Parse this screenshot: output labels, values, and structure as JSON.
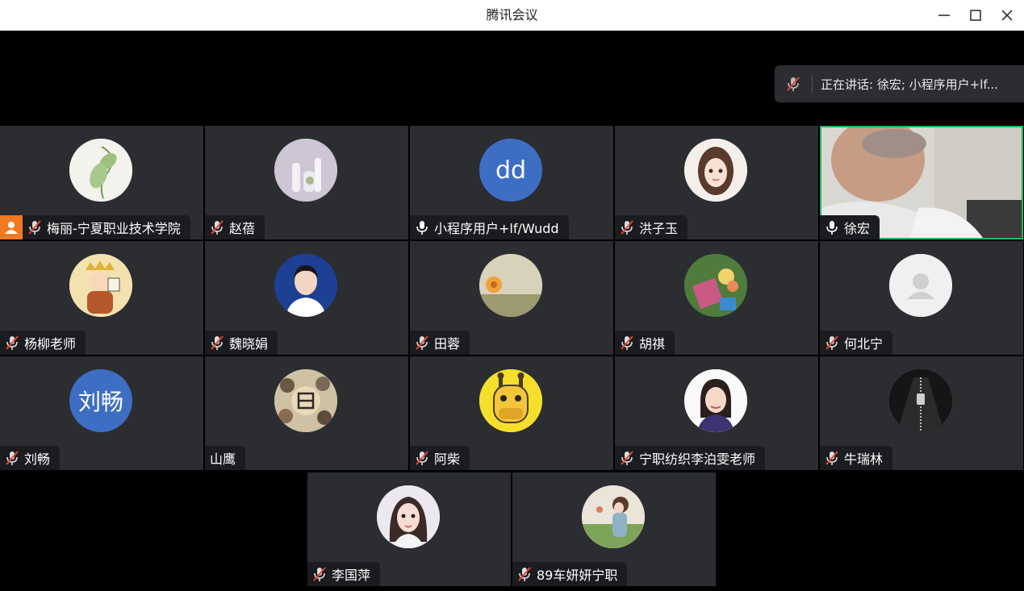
{
  "window": {
    "title": "腾讯会议"
  },
  "speaking": {
    "text": "正在讲话:  徐宏; 小程序用户+lf..."
  },
  "participants": [
    {
      "name": "梅丽-宁夏职业技术学院",
      "muted": true,
      "host": true,
      "avatar": "leaf-plant"
    },
    {
      "name": "赵蓓",
      "muted": true,
      "avatar": "white-vase"
    },
    {
      "name": "小程序用户+lf/Wudd",
      "muted": false,
      "avatar_text": "dd"
    },
    {
      "name": "洪子玉",
      "muted": true,
      "avatar": "cartoon-girl"
    },
    {
      "name": "徐宏",
      "muted": false,
      "video": true
    },
    {
      "name": "杨柳老师",
      "muted": true,
      "avatar": "cartoon-liberty"
    },
    {
      "name": "魏晓娟",
      "muted": true,
      "avatar": "woman-portrait"
    },
    {
      "name": "田蓉",
      "muted": true,
      "avatar": "orange-flower"
    },
    {
      "name": "胡祺",
      "muted": true,
      "avatar": "flowers-outdoor"
    },
    {
      "name": "何北宁",
      "muted": true,
      "avatar": "default-person"
    },
    {
      "name": "刘畅",
      "muted": true,
      "avatar_text": "刘畅"
    },
    {
      "name": "山鹰",
      "muted": false,
      "avatar": "photo-collage"
    },
    {
      "name": "阿柴",
      "muted": true,
      "avatar": "giraffe-cartoon"
    },
    {
      "name": "宁职纺织李泊雯老师",
      "muted": true,
      "avatar": "woman-smile"
    },
    {
      "name": "牛瑞林",
      "muted": true,
      "avatar": "leather-jacket"
    },
    {
      "name": "李国萍",
      "muted": true,
      "avatar": "anime-woman"
    },
    {
      "name": "89车妍妍宁职",
      "muted": true,
      "avatar": "girl-field"
    }
  ],
  "colors": {
    "active_speaker_border": "#28b463",
    "host_badge": "#f07a1f",
    "text_avatar_bg": "#3d6ec4",
    "muted_mic": "#e0453a"
  }
}
